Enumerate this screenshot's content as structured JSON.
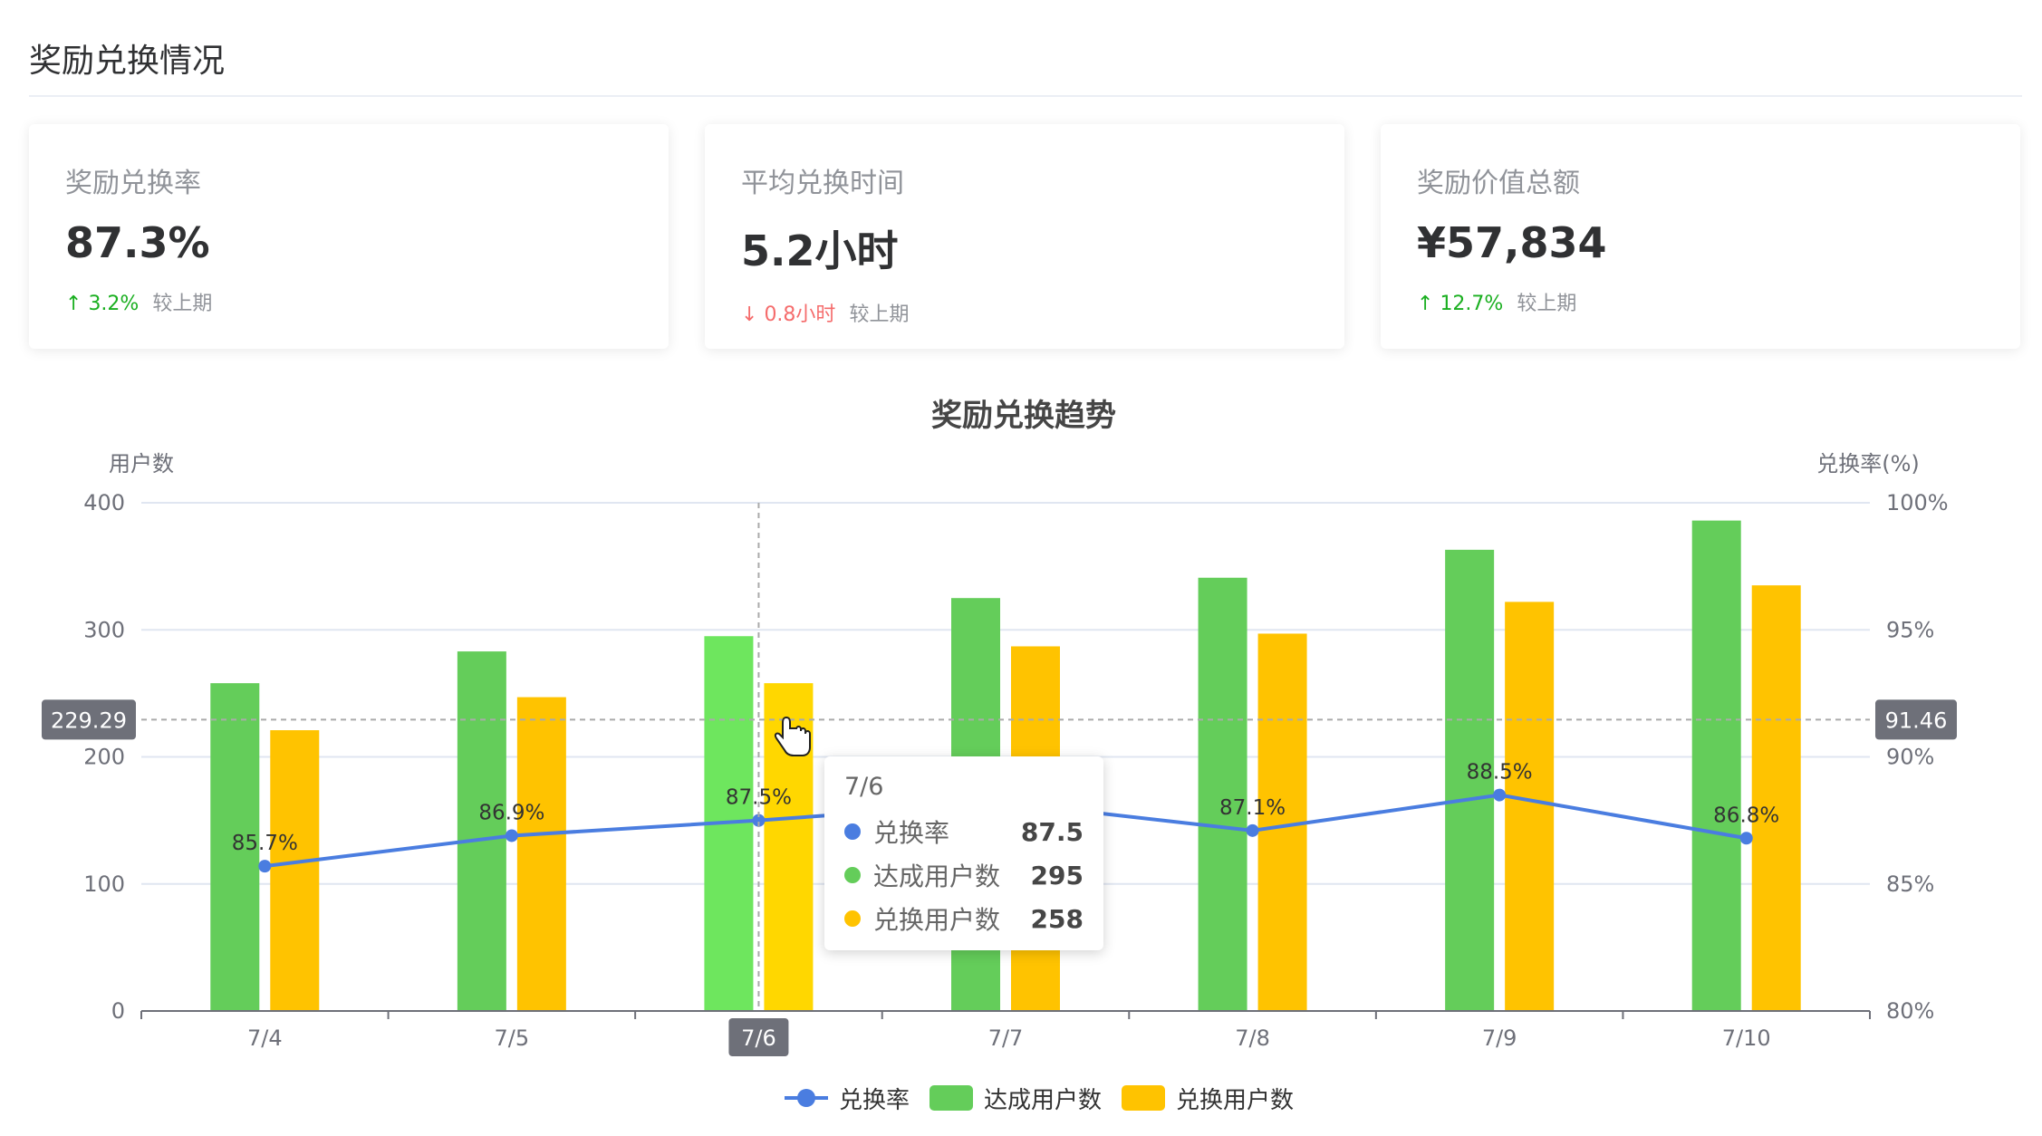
{
  "section_title": "奖励兑换情况",
  "cards": [
    {
      "label": "奖励兑换率",
      "value": "87.3%",
      "trend_arrow": "↑",
      "trend_value": "3.2%",
      "trend_dir": "up",
      "compare": "较上期"
    },
    {
      "label": "平均兑换时间",
      "value": "5.2小时",
      "trend_arrow": "↓",
      "trend_value": "0.8小时",
      "trend_dir": "down",
      "compare": "较上期"
    },
    {
      "label": "奖励价值总额",
      "value": "¥57,834",
      "trend_arrow": "↑",
      "trend_value": "12.7%",
      "trend_dir": "up",
      "compare": "较上期"
    }
  ],
  "chart_data": {
    "type": "bar",
    "title": "奖励兑换趋势",
    "categories": [
      "7/4",
      "7/5",
      "7/6",
      "7/7",
      "7/8",
      "7/9",
      "7/10"
    ],
    "y_left": {
      "label": "用户数",
      "min": 0,
      "max": 400,
      "ticks": [
        "0",
        "100",
        "200",
        "300",
        "400"
      ]
    },
    "y_right": {
      "label": "兑换率(%)",
      "min": 80,
      "max": 100,
      "ticks": [
        "80%",
        "85%",
        "90%",
        "95%",
        "100%"
      ]
    },
    "series": [
      {
        "name": "兑换率",
        "kind": "line",
        "axis": "right",
        "color": "#4a7de0",
        "values": [
          85.7,
          86.9,
          87.5,
          88.2,
          87.1,
          88.5,
          86.8
        ],
        "labels": [
          "85.7%",
          "86.9%",
          "87.5%",
          "",
          "87.1%",
          "88.5%",
          "86.8%"
        ]
      },
      {
        "name": "达成用户数",
        "kind": "bar",
        "axis": "left",
        "color": "#64cd5a",
        "highlight": "#6ee65e",
        "values": [
          258,
          283,
          295,
          325,
          341,
          363,
          386
        ]
      },
      {
        "name": "兑换用户数",
        "kind": "bar",
        "axis": "left",
        "color": "#ffc300",
        "highlight": "#ffd700",
        "values": [
          221,
          247,
          258,
          287,
          297,
          322,
          335
        ]
      }
    ],
    "highlight_index": 2,
    "pointer": {
      "left_value": "229.29",
      "right_value": "91.46",
      "left_num": 229.29
    },
    "grid": true,
    "legend_position": "bottom"
  },
  "tooltip": {
    "title": "7/6",
    "rows": [
      {
        "name": "兑换率",
        "value": "87.5",
        "color": "#4a7de0"
      },
      {
        "name": "达成用户数",
        "value": "295",
        "color": "#64cd5a"
      },
      {
        "name": "兑换用户数",
        "value": "258",
        "color": "#ffc300"
      }
    ]
  }
}
